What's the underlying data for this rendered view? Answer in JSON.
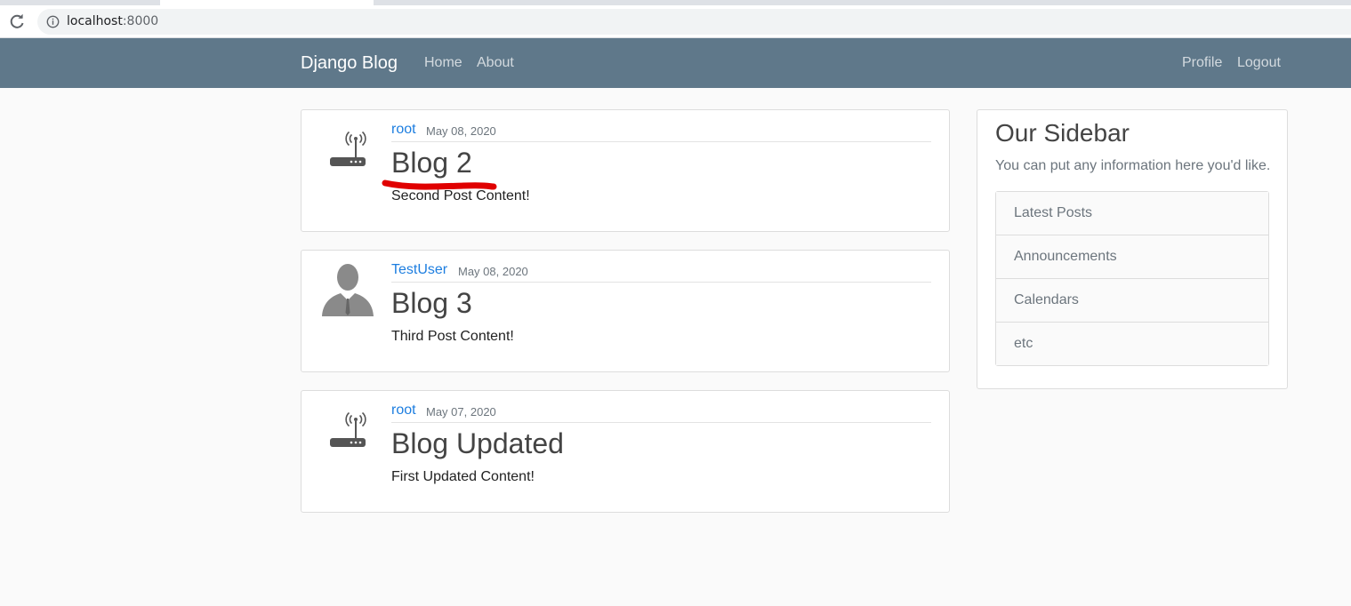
{
  "browser": {
    "url_host": "localhost",
    "url_port": ":8000"
  },
  "navbar": {
    "brand": "Django Blog",
    "links": [
      "Home",
      "About"
    ],
    "right_links": [
      "Profile",
      "Logout"
    ],
    "color": "#5f788a"
  },
  "posts": [
    {
      "author": "root",
      "date": "May 08, 2020",
      "title": "Blog 2",
      "content": "Second Post Content!",
      "avatar_icon": "router-icon"
    },
    {
      "author": "TestUser",
      "date": "May 08, 2020",
      "title": "Blog 3",
      "content": "Third Post Content!",
      "avatar_icon": "user-silhouette-icon"
    },
    {
      "author": "root",
      "date": "May 07, 2020",
      "title": "Blog Updated",
      "content": "First Updated Content!",
      "avatar_icon": "router-icon"
    }
  ],
  "sidebar": {
    "title": "Our Sidebar",
    "lead": "You can put any information here you'd like.",
    "items": [
      "Latest Posts",
      "Announcements",
      "Calendars",
      "etc"
    ]
  },
  "annotation": {
    "color": "#e00000"
  }
}
